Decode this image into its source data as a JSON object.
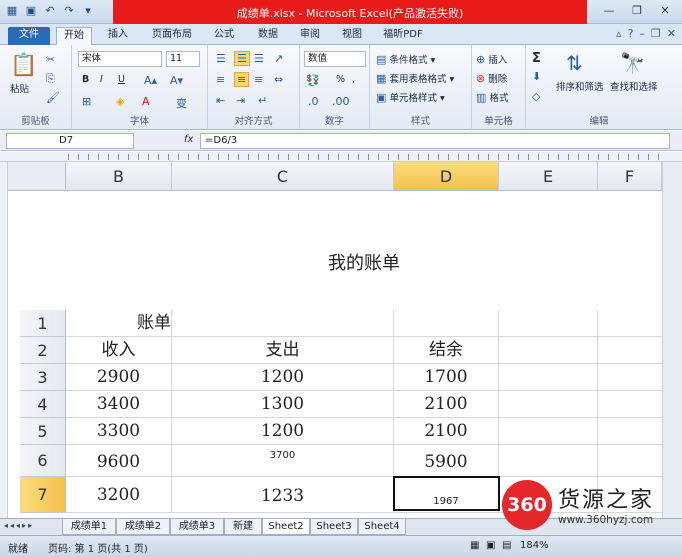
{
  "window": {
    "title": "成绩单.xlsx - Microsoft Excel(产品激活失败)",
    "title_bar_color": "#e81b1b"
  },
  "ribbon_tabs": [
    "文件",
    "开始",
    "插入",
    "页面布局",
    "公式",
    "数据",
    "审阅",
    "视图",
    "福昕PDF"
  ],
  "clipboard": {
    "paste": "粘贴",
    "label": "剪贴板"
  },
  "font": {
    "name": "宋体",
    "size": "11",
    "bold": "B",
    "italic": "I",
    "underline": "U",
    "label": "字体"
  },
  "alignment": {
    "label": "对齐方式"
  },
  "number": {
    "format": "数值",
    "percent": "%",
    "comma": ",",
    "label": "数字"
  },
  "styles": {
    "conditional": "条件格式",
    "table": "套用表格格式",
    "cell": "单元格样式",
    "label": "样式"
  },
  "cells": {
    "insert": "插入",
    "delete": "删除",
    "format": "格式",
    "label": "单元格"
  },
  "editing": {
    "sort": "排序和筛选",
    "find": "查找和选择",
    "label": "编辑"
  },
  "formula_bar": {
    "name_box": "D7",
    "fx": "fx",
    "formula": "=D6/3"
  },
  "columns": [
    "B",
    "C",
    "D",
    "E",
    "F"
  ],
  "page_header_title": "我的账单",
  "rows": [
    {
      "num": "1",
      "b": "账单",
      "c": "",
      "d": ""
    },
    {
      "num": "2",
      "b": "收入",
      "c": "支出",
      "d": "结余"
    },
    {
      "num": "3",
      "b": "2900",
      "c": "1200",
      "d": "1700"
    },
    {
      "num": "4",
      "b": "3400",
      "c": "1300",
      "d": "2100"
    },
    {
      "num": "5",
      "b": "3300",
      "c": "1200",
      "d": "2100"
    },
    {
      "num": "6",
      "b": "9600",
      "c": "3700",
      "d": "5900"
    },
    {
      "num": "7",
      "b": "3200",
      "c": "1233",
      "d": "1967"
    }
  ],
  "sheet_tabs": [
    "成绩单1",
    "成绩单2",
    "成绩单3",
    "新建",
    "Sheet2",
    "Sheet3",
    "Sheet4"
  ],
  "status": {
    "mode": "就绪",
    "page": "页码: 第 1 页(共 1 页)",
    "zoom": "184%"
  },
  "watermark": {
    "badge": "360",
    "name": "货源之家",
    "url": "www.360hyzj.com",
    "color": "#e5262b"
  }
}
